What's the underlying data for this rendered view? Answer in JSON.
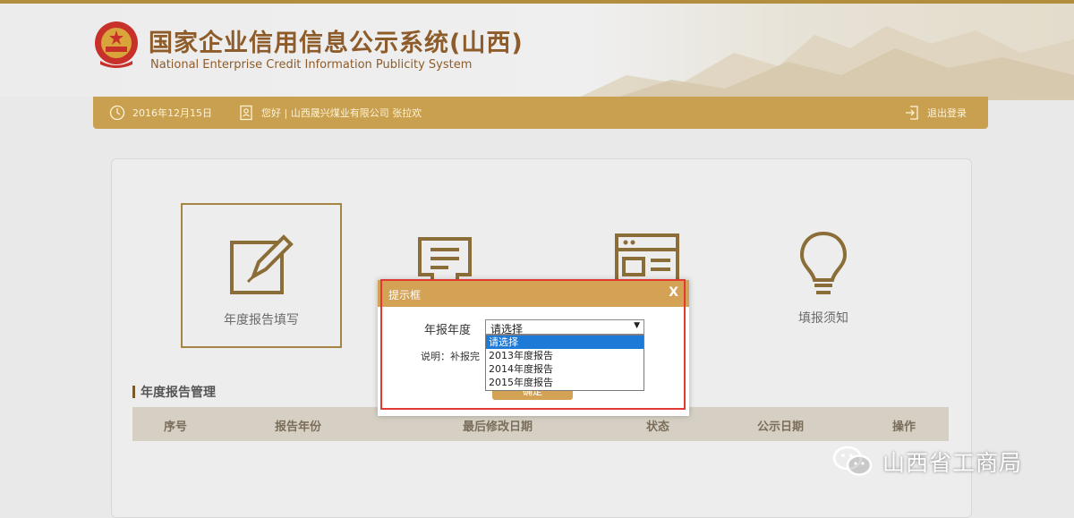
{
  "header": {
    "title": "国家企业信用信息公示系统(山西)",
    "subtitle": "National Enterprise Credit Information Publicity System"
  },
  "user_bar": {
    "date": "2016年12月15日",
    "greeting": "您好 | 山西晟兴煤业有限公司   张拉欢",
    "logout": "退出登录"
  },
  "cards": [
    {
      "label": "年度报告填写",
      "icon": "edit-icon"
    },
    {
      "label": "",
      "icon": "document-icon"
    },
    {
      "label": "",
      "icon": "browser-icon"
    },
    {
      "label": "填报须知",
      "icon": "lightbulb-icon"
    }
  ],
  "section": {
    "title": "年度报告管理",
    "columns": [
      "序号",
      "报告年份",
      "最后修改日期",
      "状态",
      "公示日期",
      "操作"
    ]
  },
  "dialog": {
    "title": "提示框",
    "close": "X",
    "year_label": "年报年度",
    "select_value": "请选择",
    "options": [
      "请选择",
      "2013年度报告",
      "2014年度报告",
      "2015年度报告"
    ],
    "note": "说明：补报完",
    "confirm": "确定"
  },
  "watermark": {
    "text": "山西省工商局",
    "icon": "wechat-icon"
  },
  "colors": {
    "gold": "#c8a04f",
    "dialog_head": "#d4a254",
    "highlight": "#e23a30",
    "selected": "#1e7ad7"
  }
}
